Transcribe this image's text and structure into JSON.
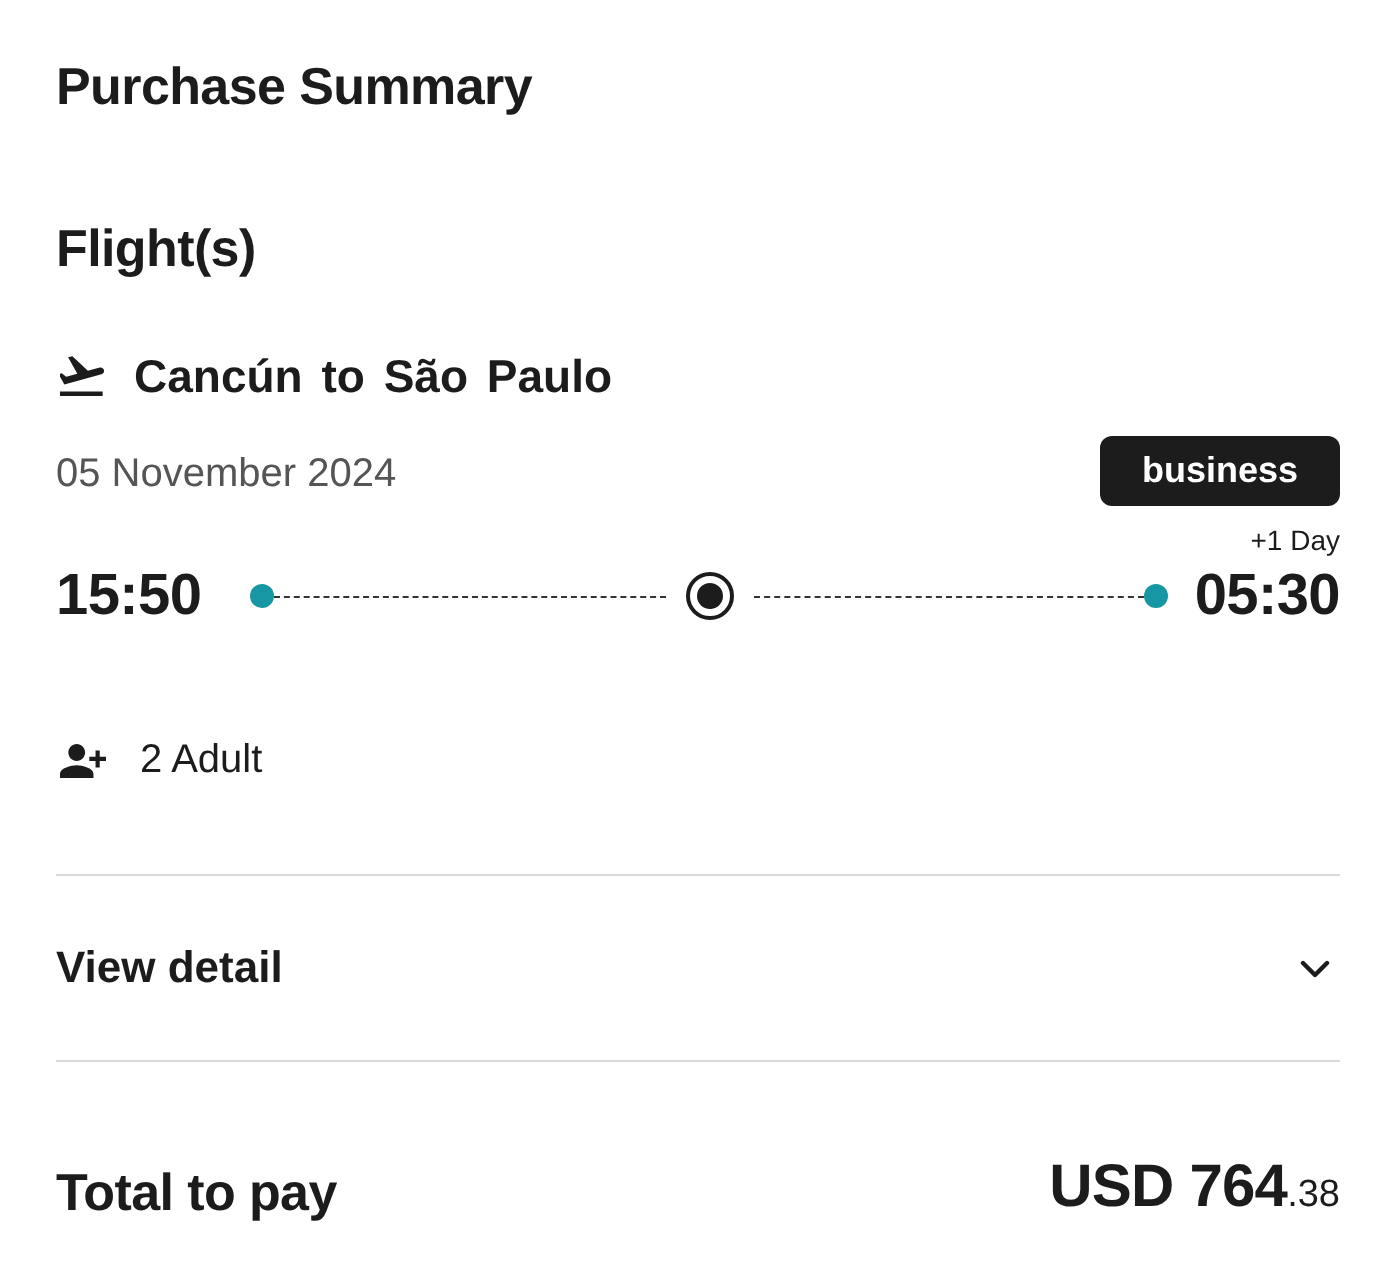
{
  "title": "Purchase Summary",
  "section_title": "Flight(s)",
  "flight": {
    "route": "Cancún to São Paulo",
    "date": "05 November 2024",
    "cabin": "business",
    "day_offset": "+1 Day",
    "departure": "15:50",
    "arrival": "05:30",
    "passengers": "2 Adult"
  },
  "detail": {
    "label": "View detail",
    "expanded": false
  },
  "total": {
    "label": "Total to pay",
    "amount": "USD 764",
    "decimals": ".38"
  }
}
